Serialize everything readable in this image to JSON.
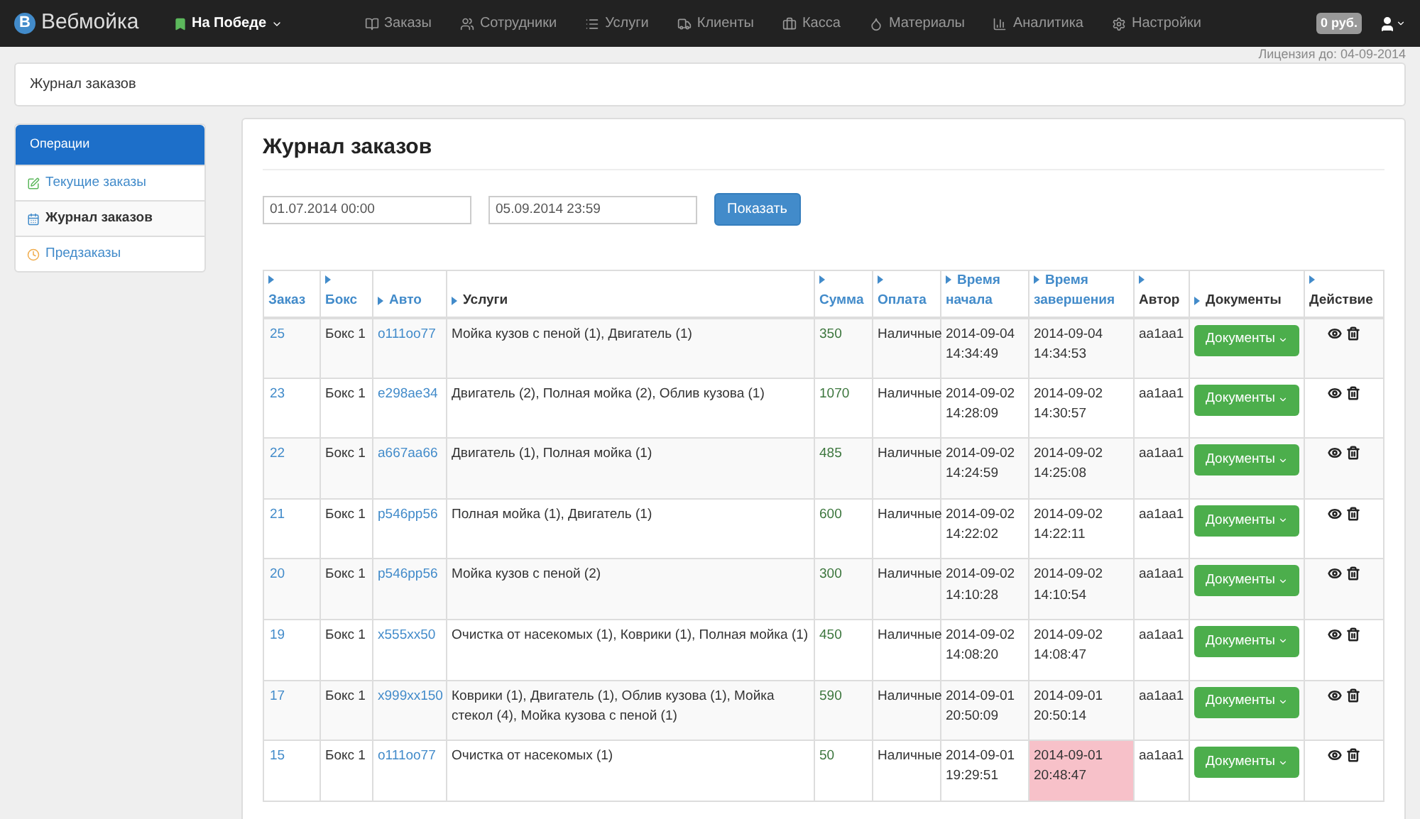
{
  "brand": {
    "badge": "B",
    "name": "Вебмойка"
  },
  "location": {
    "label": "На Победе"
  },
  "nav": [
    {
      "label": "Заказы"
    },
    {
      "label": "Сотрудники"
    },
    {
      "label": "Услуги"
    },
    {
      "label": "Клиенты"
    },
    {
      "label": "Касса"
    },
    {
      "label": "Материалы"
    },
    {
      "label": "Аналитика"
    },
    {
      "label": "Настройки"
    }
  ],
  "balance": "0 руб.",
  "license": "Лицензия до: 04-09-2014",
  "breadcrumb": "Журнал заказов",
  "sidebar": {
    "header": "Операции",
    "items": [
      {
        "label": "Текущие заказы",
        "selected": false
      },
      {
        "label": "Журнал заказов",
        "selected": true
      },
      {
        "label": "Предзаказы",
        "selected": false
      }
    ]
  },
  "page_title": "Журнал заказов",
  "filter": {
    "from": "01.07.2014 00:00",
    "to": "05.09.2014 23:59",
    "button": "Показать"
  },
  "table": {
    "columns": [
      {
        "label": "Заказ",
        "link": true
      },
      {
        "label": "Бокс",
        "link": true
      },
      {
        "label": "Авто",
        "link": true
      },
      {
        "label": "Услуги",
        "link": false
      },
      {
        "label": "Сумма",
        "link": true
      },
      {
        "label": "Оплата",
        "link": true
      },
      {
        "label": "Время начала",
        "link": true
      },
      {
        "label": "Время завершения",
        "link": true
      },
      {
        "label": "Автор",
        "link": false
      },
      {
        "label": "Документы",
        "link": false
      },
      {
        "label": "Действие",
        "link": false
      }
    ],
    "rows": [
      {
        "order": "25",
        "box": "Бокс 1",
        "car": "о111оо77",
        "services": "Мойка кузов с пеной (1), Двигатель (1)",
        "sum": "350",
        "payment": "Наличные",
        "start": "2014-09-04 14:34:49",
        "end": "2014-09-04 14:34:53",
        "overdue": false,
        "author": "aa1aa1",
        "docs": "Документы"
      },
      {
        "order": "23",
        "box": "Бокс 1",
        "car": "е298ае34",
        "services": "Двигатель (2), Полная мойка (2), Облив кузова (1)",
        "sum": "1070",
        "payment": "Наличные",
        "start": "2014-09-02 14:28:09",
        "end": "2014-09-02 14:30:57",
        "overdue": false,
        "author": "aa1aa1",
        "docs": "Документы"
      },
      {
        "order": "22",
        "box": "Бокс 1",
        "car": "а667аа66",
        "services": "Двигатель (1), Полная мойка (1)",
        "sum": "485",
        "payment": "Наличные",
        "start": "2014-09-02 14:24:59",
        "end": "2014-09-02 14:25:08",
        "overdue": false,
        "author": "aa1aa1",
        "docs": "Документы"
      },
      {
        "order": "21",
        "box": "Бокс 1",
        "car": "р546рр56",
        "services": "Полная мойка (1), Двигатель (1)",
        "sum": "600",
        "payment": "Наличные",
        "start": "2014-09-02 14:22:02",
        "end": "2014-09-02 14:22:11",
        "overdue": false,
        "author": "aa1aa1",
        "docs": "Документы"
      },
      {
        "order": "20",
        "box": "Бокс 1",
        "car": "р546рр56",
        "services": "Мойка кузов с пеной (2)",
        "sum": "300",
        "payment": "Наличные",
        "start": "2014-09-02 14:10:28",
        "end": "2014-09-02 14:10:54",
        "overdue": false,
        "author": "aa1aa1",
        "docs": "Документы"
      },
      {
        "order": "19",
        "box": "Бокс 1",
        "car": "х555хх50",
        "services": "Очистка от насекомых (1), Коврики (1), Полная мойка (1)",
        "sum": "450",
        "payment": "Наличные",
        "start": "2014-09-02 14:08:20",
        "end": "2014-09-02 14:08:47",
        "overdue": false,
        "author": "aa1aa1",
        "docs": "Документы"
      },
      {
        "order": "17",
        "box": "Бокс 1",
        "car": "х999хх150",
        "services": "Коврики (1), Двигатель (1), Облив кузова (1), Мойка стекол (4), Мойка кузова с пеной (1)",
        "sum": "590",
        "payment": "Наличные",
        "start": "2014-09-01 20:50:09",
        "end": "2014-09-01 20:50:14",
        "overdue": false,
        "author": "aa1aa1",
        "docs": "Документы"
      },
      {
        "order": "15",
        "box": "Бокс 1",
        "car": "о111оо77",
        "services": "Очистка от насекомых (1)",
        "sum": "50",
        "payment": "Наличные",
        "start": "2014-09-01 19:29:51",
        "end": "2014-09-01 20:48:47",
        "overdue": true,
        "author": "aa1aa1",
        "docs": "Документы"
      }
    ]
  }
}
